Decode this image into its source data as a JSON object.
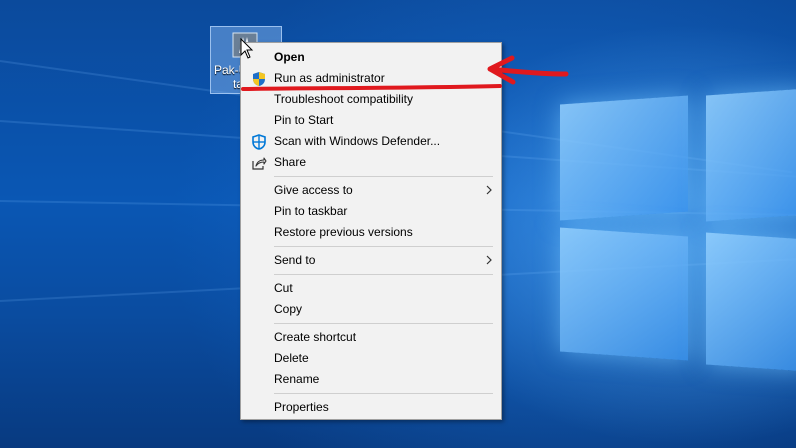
{
  "desktop_icon": {
    "label": "Pak-U",
    "label2": "ta"
  },
  "menu": {
    "groups": [
      [
        {
          "label": "Open",
          "bold": true
        },
        {
          "label": "Run as administrator",
          "icon": "uac-shield-icon"
        },
        {
          "label": "Troubleshoot compatibility"
        },
        {
          "label": "Pin to Start"
        },
        {
          "label": "Scan with Windows Defender...",
          "icon": "windows-defender-icon"
        },
        {
          "label": "Share",
          "icon": "share-icon"
        }
      ],
      [
        {
          "label": "Give access to",
          "submenu": true
        },
        {
          "label": "Pin to taskbar"
        },
        {
          "label": "Restore previous versions"
        }
      ],
      [
        {
          "label": "Send to",
          "submenu": true
        }
      ],
      [
        {
          "label": "Cut"
        },
        {
          "label": "Copy"
        }
      ],
      [
        {
          "label": "Create shortcut"
        },
        {
          "label": "Delete"
        },
        {
          "label": "Rename"
        }
      ],
      [
        {
          "label": "Properties"
        }
      ]
    ]
  },
  "colors": {
    "annotation": "#e0191e",
    "accent": "#0078d7"
  }
}
